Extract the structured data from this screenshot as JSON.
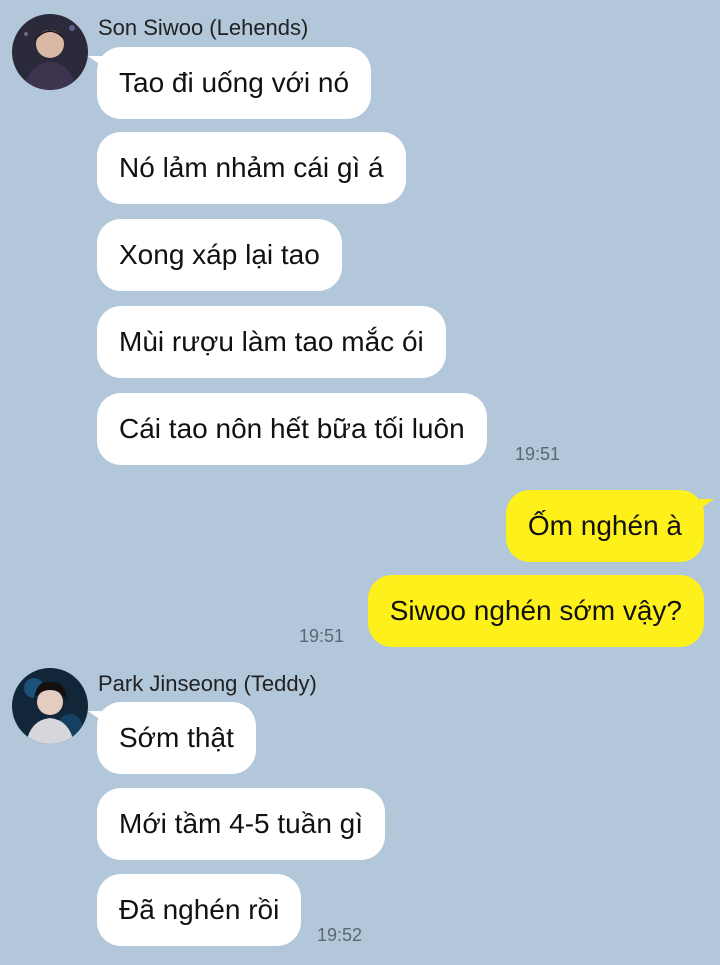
{
  "groups": [
    {
      "sender": "Son Siwoo (Lehends)",
      "messages": [
        "Tao đi uống với nó",
        "Nó lảm nhảm cái gì á",
        "Xong xáp lại tao",
        "Mùi rượu làm tao mắc ói",
        "Cái tao nôn hết bữa tối luôn"
      ],
      "time": "19:51"
    },
    {
      "sender": "me",
      "messages": [
        "Ốm nghén à",
        "Siwoo nghén sớm vậy?"
      ],
      "time": "19:51"
    },
    {
      "sender": "Park Jinseong (Teddy)",
      "messages": [
        "Sớm thật",
        "Mới tầm 4-5 tuần gì",
        "Đã nghén rồi"
      ],
      "time": "19:52"
    }
  ],
  "colors": {
    "background": "#b2c7da",
    "incoming_bubble": "#ffffff",
    "outgoing_bubble": "#fef01b"
  }
}
